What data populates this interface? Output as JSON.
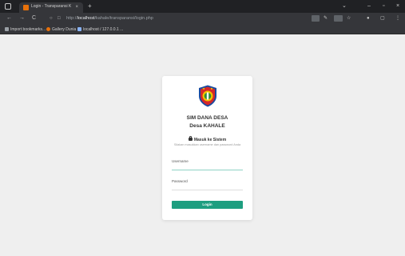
{
  "browser": {
    "tab_title": "Login - Transparansi Keuan",
    "tab_close": "×",
    "new_tab": "+",
    "window_controls": {
      "dropdown": "⌄",
      "minimize": "–",
      "maximize": "▫",
      "close": "×"
    },
    "nav": {
      "back": "←",
      "forward": "→",
      "reload": "C"
    },
    "url_prefix": "http://",
    "url_host": "localhost",
    "url_path": "/kahale/transparansi/login.php",
    "bookmarks": [
      {
        "label": "Import bookmarks...",
        "color": "#5f6368"
      },
      {
        "label": "Gallery Dunia",
        "color": "#e8710a"
      },
      {
        "label": "localhost / 127.0.0.1 ...",
        "color": "#8ab4f8"
      }
    ]
  },
  "login": {
    "title_line1": "SIM DANA DESA",
    "title_line2": "Desa KAHALE",
    "heading": "Masuk ke Sistem",
    "description": "Silakan masukkan username dan password Anda",
    "username_label": "Username",
    "username_value": "",
    "password_label": "Password",
    "password_value": "",
    "submit_label": "Login"
  },
  "colors": {
    "accent": "#1e9e80",
    "page_background": "#efefef",
    "card_background": "#ffffff"
  },
  "icons": [
    "window-icon",
    "tab-favicon",
    "shield-logo",
    "lock-icon",
    "info-icon",
    "star-icon",
    "extension-icon",
    "profile-icon",
    "menu-icon"
  ]
}
